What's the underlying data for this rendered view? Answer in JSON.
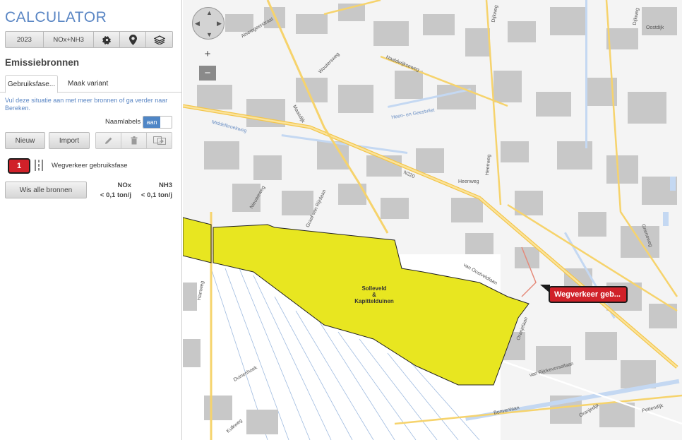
{
  "app": {
    "title": "CALCULATOR"
  },
  "toolbar": {
    "year": "2023",
    "substance": "NOx+NH3"
  },
  "section": {
    "title": "Emissiebronnen"
  },
  "tabs": [
    {
      "label": "Gebruiksfase..."
    },
    {
      "label": "Maak variant"
    }
  ],
  "hint": "Vul deze situatie aan met meer bronnen of ga verder naar Bereken.",
  "labels_toggle": {
    "label": "Naamlabels",
    "state": "aan"
  },
  "actions": {
    "new_label": "Nieuw",
    "import_label": "Import",
    "clear_label": "Wis alle bronnen"
  },
  "sources": [
    {
      "number": "1",
      "label": "Wegverkeer gebruiksfase",
      "icon": "road-traffic-icon"
    }
  ],
  "totals": {
    "nox_header": "NOx",
    "nh3_header": "NH3",
    "nox_value": "< 0,1 ton/j",
    "nh3_value": "< 0,1 ton/j"
  },
  "map": {
    "zoom_in": "+",
    "zoom_out": "−",
    "area_label_line1": "Solleveld",
    "area_label_line2": "&",
    "area_label_line3": "Kapittelduinen",
    "source_tag": "Wegverkeer geb...",
    "area_color": "#e8e620",
    "street_labels": [
      "Alsemgeerstraat",
      "Woutersweg",
      "Naaldwijkseweg",
      "Dijkweg",
      "Heen- en Geestvliet",
      "Maasdijk",
      "Middelbroekweg",
      "N220",
      "Heenweg",
      "Nieuweweg",
      "Graaf van Rijnlaan",
      "Hamweg",
      "van Oostveldlaan",
      "van Rijckevorsellaan",
      "Duinenhoek",
      "Kulkweg",
      "Bonvenlaan",
      "Oranjedijk",
      "Grieneweg",
      "Oostdijk",
      "Pettendijk",
      "Heenweg",
      "Dijkweg",
      "Oranjelaan"
    ]
  },
  "colors": {
    "accent": "#5a86c4",
    "source_red": "#d02129",
    "toggle_on": "#4f86c6"
  }
}
